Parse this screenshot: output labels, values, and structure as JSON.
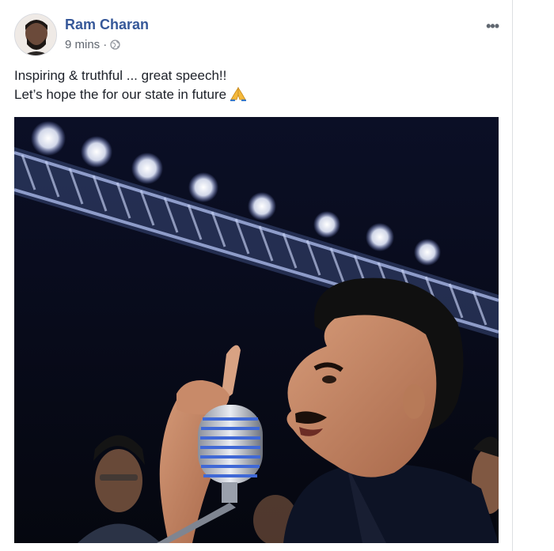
{
  "post": {
    "author": "Ram Charan",
    "time": "9 mins",
    "separator": "·",
    "privacy_icon": "globe-icon",
    "menu_icon": "more-options-icon",
    "menu_label": "•••",
    "text_line1": "Inspiring & truthful ... great speech!!",
    "text_line2": "Let’s hope the for our state in future",
    "emoji": "folded-hands-emoji"
  },
  "colors": {
    "author_link": "#365899",
    "meta_text": "#616770",
    "body_text": "#1d2129",
    "photo_background": "#070a1d"
  }
}
